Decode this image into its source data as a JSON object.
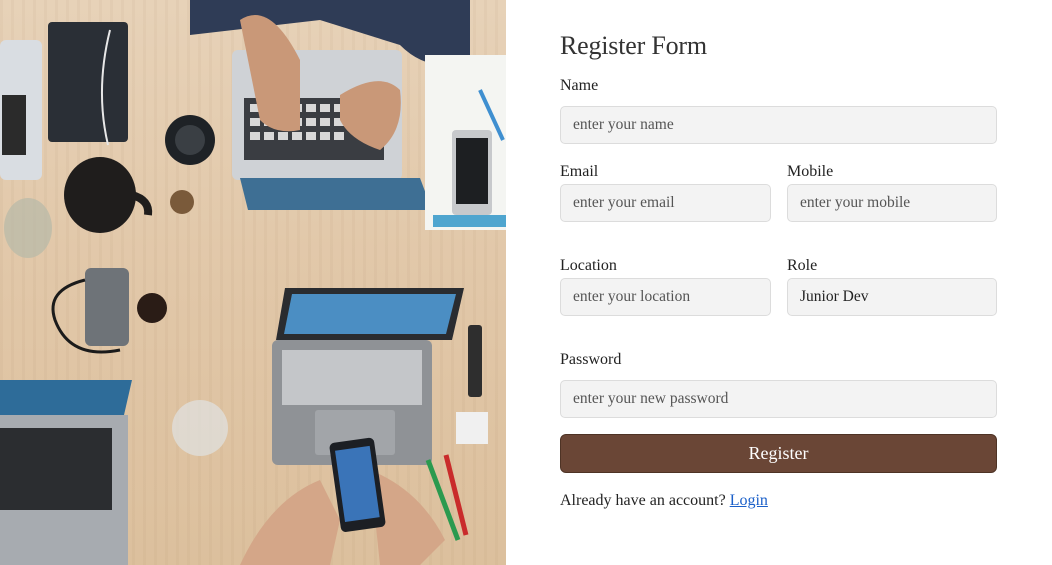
{
  "photo": {
    "description_icon": "workspace-photo"
  },
  "form": {
    "title": "Register Form",
    "name": {
      "label": "Name",
      "placeholder": "enter your name"
    },
    "email": {
      "label": "Email",
      "placeholder": "enter your email"
    },
    "mobile": {
      "label": "Mobile",
      "placeholder": "enter your mobile"
    },
    "location": {
      "label": "Location",
      "placeholder": "enter your location"
    },
    "role": {
      "label": "Role",
      "value": "Junior Dev"
    },
    "password": {
      "label": "Password",
      "placeholder": "enter your new password"
    },
    "register_label": "Register",
    "footer_text": "Already have an account?",
    "login_label": "Login"
  },
  "colors": {
    "accent": "#6a4636",
    "link": "#1a5fc9",
    "input_bg": "#f3f3f3"
  }
}
